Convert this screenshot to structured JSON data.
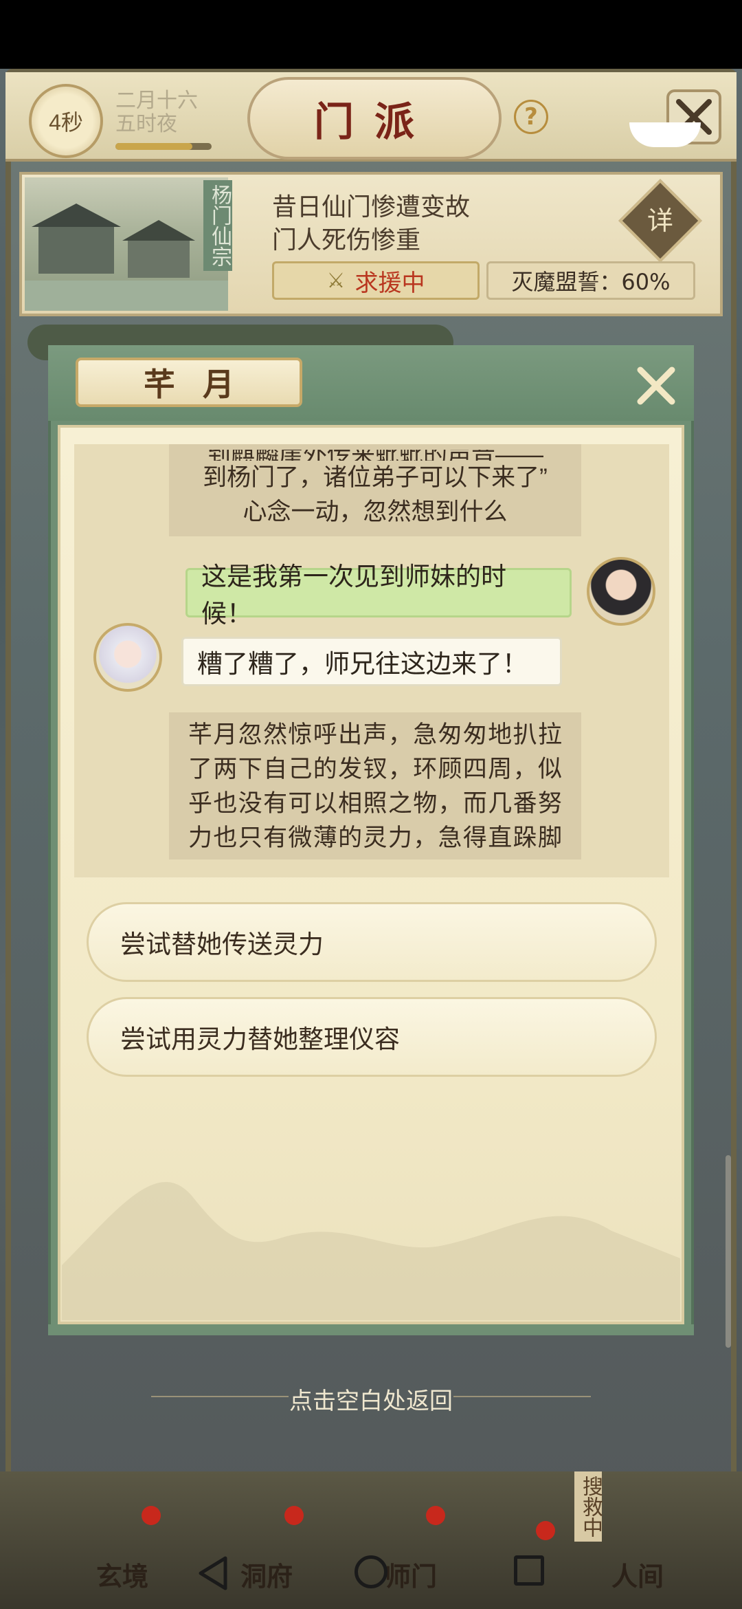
{
  "header": {
    "timer": "4秒",
    "date_line1": "二月十六",
    "date_line2": "五时夜",
    "title": "门派",
    "help_icon": "question-mark-icon",
    "close_icon": "crossed-swords-close-icon"
  },
  "sect": {
    "vertical_name": "杨门仙宗",
    "line1": "昔日仙门惨遭变故",
    "line2": "门人死伤惨重",
    "detail_label": "详",
    "rescue_label": "求援中",
    "alliance_label": "灭魔盟誓：60%",
    "alliance_progress": 0.6
  },
  "dialog": {
    "title": "芊月",
    "close_icon": "close-x-icon",
    "narration_top": {
      "cut_line": "到麒麟崖外传来蚍蚍的声音——",
      "line1": "到杨门了，诸位弟子可以下来了”",
      "line2": "心念一动，忽然想到什么"
    },
    "player_line": "这是我第一次见到师妹的时候！",
    "npc_line": "糟了糟了，师兄往这边来了！",
    "narration_bottom": [
      "芊月忽然惊呼出声，急匆匆地扒拉",
      "了两下自己的发钗，环顾四周，似",
      "乎也没有可以相照之物，而几番努",
      "力也只有微薄的灵力，急得直跺脚"
    ],
    "choices": [
      "尝试替她传送灵力",
      "尝试用灵力替她整理仪容"
    ]
  },
  "return_hint": "点击空白处返回",
  "bottom_nav": {
    "items": [
      "玄境",
      "洞府",
      "师门",
      "人间"
    ],
    "search_rescue": "搜救中"
  },
  "colors": {
    "dialog_green": "#6f8f74",
    "paper": "#f7f0d4",
    "player_bubble": "#cfe8a6",
    "rescue_red": "#b9361f"
  }
}
